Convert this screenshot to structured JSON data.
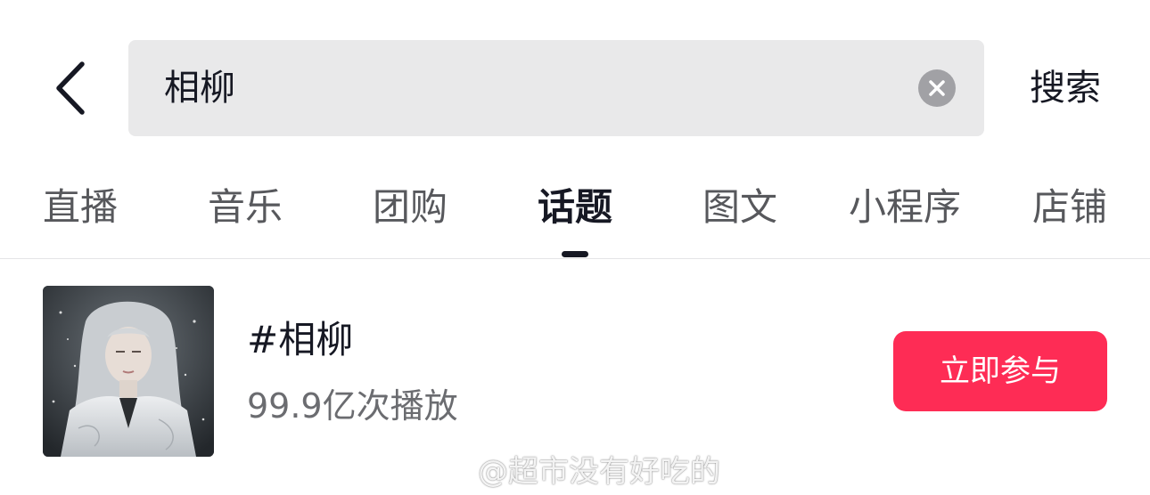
{
  "header": {
    "back_icon": "chevron-left-icon",
    "search_value": "相柳",
    "clear_icon": "clear-circle-icon",
    "search_button_label": "搜索"
  },
  "tabs": [
    {
      "label": "直播",
      "active": false
    },
    {
      "label": "音乐",
      "active": false
    },
    {
      "label": "团购",
      "active": false
    },
    {
      "label": "话题",
      "active": true
    },
    {
      "label": "图文",
      "active": false
    },
    {
      "label": "小程序",
      "active": false
    },
    {
      "label": "店铺",
      "active": false
    }
  ],
  "result": {
    "title": "#相柳",
    "views": "99.9亿次播放",
    "join_button_label": "立即参与",
    "thumbnail_icon": "topic-cover-image"
  },
  "watermark": {
    "icon": "weibo-logo-icon",
    "text": "@超市没有好吃的"
  },
  "colors": {
    "accent": "#fe2c55",
    "text_primary": "#161823",
    "text_secondary": "#6b6c70",
    "search_bg": "#e9e9ea"
  }
}
